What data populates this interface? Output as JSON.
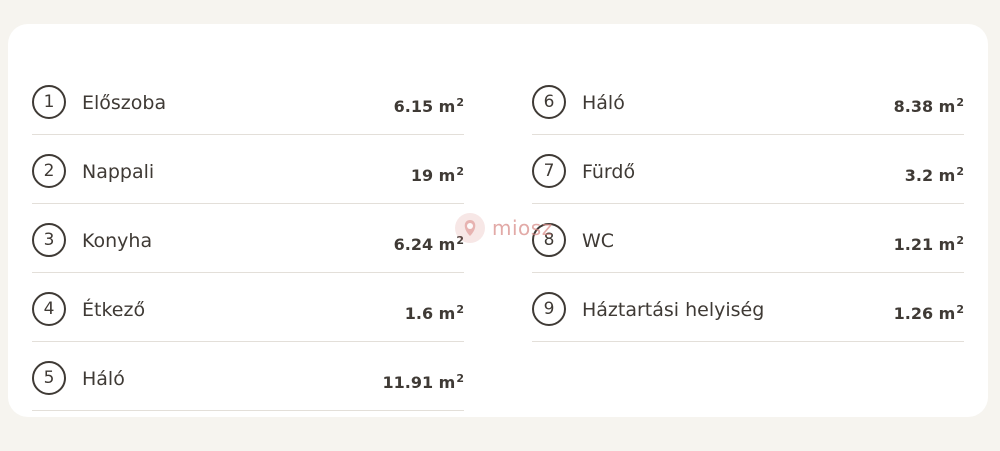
{
  "rooms_left": [
    {
      "number": "1",
      "name": "Előszoba",
      "area": "6.15",
      "unit": "m",
      "sup": "2"
    },
    {
      "number": "2",
      "name": "Nappali",
      "area": "19",
      "unit": "m",
      "sup": "2"
    },
    {
      "number": "3",
      "name": "Konyha",
      "area": "6.24",
      "unit": "m",
      "sup": "2"
    },
    {
      "number": "4",
      "name": "Étkező",
      "area": "1.6",
      "unit": "m",
      "sup": "2"
    },
    {
      "number": "5",
      "name": "Háló",
      "area": "11.91",
      "unit": "m",
      "sup": "2"
    }
  ],
  "rooms_right": [
    {
      "number": "6",
      "name": "Háló",
      "area": "8.38",
      "unit": "m",
      "sup": "2"
    },
    {
      "number": "7",
      "name": "Fürdő",
      "area": "3.2",
      "unit": "m",
      "sup": "2"
    },
    {
      "number": "8",
      "name": "WC",
      "area": "1.21",
      "unit": "m",
      "sup": "2"
    },
    {
      "number": "9",
      "name": "Háztartási helyiség",
      "area": "1.26",
      "unit": "m",
      "sup": "2"
    }
  ],
  "watermark": {
    "text": "miosz",
    "icon": "miosz-logo-icon",
    "color": "#d88a86"
  },
  "colors": {
    "background": "#f6f4ef",
    "card": "#ffffff",
    "text": "#3f3a35",
    "divider": "#e3dfd9"
  }
}
